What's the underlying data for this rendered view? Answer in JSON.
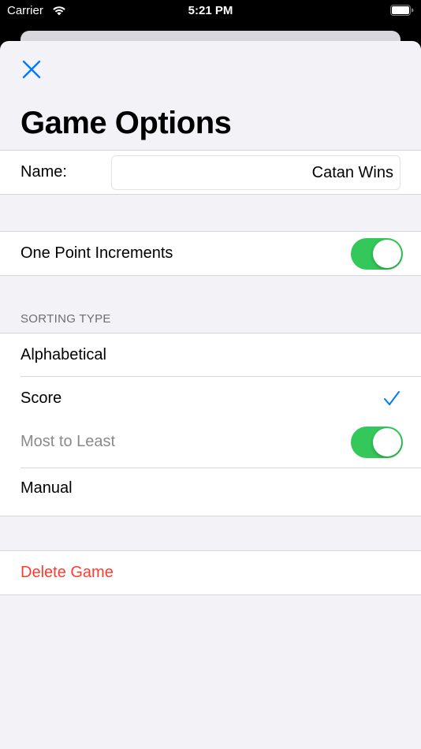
{
  "status_bar": {
    "carrier": "Carrier",
    "time": "5:21 PM"
  },
  "header": {
    "title": "Game Options",
    "close_icon": "close-icon"
  },
  "name_row": {
    "label": "Name:",
    "value": "Catan Wins"
  },
  "increments_row": {
    "label": "One Point Increments",
    "toggle_on": true
  },
  "sorting": {
    "header": "SORTING TYPE",
    "options": [
      {
        "label": "Alphabetical",
        "selected": false
      },
      {
        "label": "Score",
        "selected": true
      },
      {
        "label": "Manual",
        "selected": false
      }
    ],
    "most_to_least": {
      "label": "Most to Least",
      "toggle_on": true
    }
  },
  "delete": {
    "label": "Delete Game"
  },
  "colors": {
    "accent": "#007aff",
    "toggle_on": "#34c759",
    "destructive": "#ff3b30",
    "background": "#f2f2f7"
  }
}
